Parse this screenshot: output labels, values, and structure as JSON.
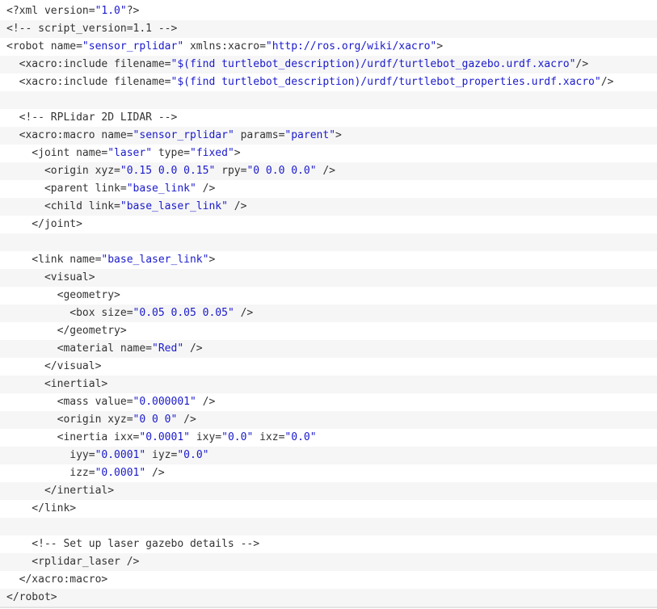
{
  "lines": [
    [
      [
        "<?xml version=",
        "t"
      ],
      [
        "\"1.0\"",
        "s"
      ],
      [
        "?>",
        "t"
      ]
    ],
    [
      [
        "<!-- script_version=1.1 -->",
        "t"
      ]
    ],
    [
      [
        "<robot name=",
        "t"
      ],
      [
        "\"sensor_rplidar\"",
        "s"
      ],
      [
        " xmlns:xacro=",
        "t"
      ],
      [
        "\"http://ros.org/wiki/xacro\"",
        "s"
      ],
      [
        ">",
        "t"
      ]
    ],
    [
      [
        "  <xacro:include filename=",
        "t"
      ],
      [
        "\"$(find turtlebot_description)/urdf/turtlebot_gazebo.urdf.xacro\"",
        "s"
      ],
      [
        "/>",
        "t"
      ]
    ],
    [
      [
        "  <xacro:include filename=",
        "t"
      ],
      [
        "\"$(find turtlebot_description)/urdf/turtlebot_properties.urdf.xacro\"",
        "s"
      ],
      [
        "/>",
        "t"
      ]
    ],
    [],
    [
      [
        "  <!-- RPLidar 2D LIDAR -->",
        "t"
      ]
    ],
    [
      [
        "  <xacro:macro name=",
        "t"
      ],
      [
        "\"sensor_rplidar\"",
        "s"
      ],
      [
        " params=",
        "t"
      ],
      [
        "\"parent\"",
        "s"
      ],
      [
        ">",
        "t"
      ]
    ],
    [
      [
        "    <joint name=",
        "t"
      ],
      [
        "\"laser\"",
        "s"
      ],
      [
        " type=",
        "t"
      ],
      [
        "\"fixed\"",
        "s"
      ],
      [
        ">",
        "t"
      ]
    ],
    [
      [
        "      <origin xyz=",
        "t"
      ],
      [
        "\"0.15 0.0 0.15\"",
        "s"
      ],
      [
        " rpy=",
        "t"
      ],
      [
        "\"0 0.0 0.0\"",
        "s"
      ],
      [
        " />",
        "t"
      ]
    ],
    [
      [
        "      <parent link=",
        "t"
      ],
      [
        "\"base_link\"",
        "s"
      ],
      [
        " />",
        "t"
      ]
    ],
    [
      [
        "      <child link=",
        "t"
      ],
      [
        "\"base_laser_link\"",
        "s"
      ],
      [
        " />",
        "t"
      ]
    ],
    [
      [
        "    </joint>",
        "t"
      ]
    ],
    [],
    [
      [
        "    <link name=",
        "t"
      ],
      [
        "\"base_laser_link\"",
        "s"
      ],
      [
        ">",
        "t"
      ]
    ],
    [
      [
        "      <visual>",
        "t"
      ]
    ],
    [
      [
        "        <geometry>",
        "t"
      ]
    ],
    [
      [
        "          <box size=",
        "t"
      ],
      [
        "\"0.05 0.05 0.05\"",
        "s"
      ],
      [
        " />",
        "t"
      ]
    ],
    [
      [
        "        </geometry>",
        "t"
      ]
    ],
    [
      [
        "        <material name=",
        "t"
      ],
      [
        "\"Red\"",
        "s"
      ],
      [
        " />",
        "t"
      ]
    ],
    [
      [
        "      </visual>",
        "t"
      ]
    ],
    [
      [
        "      <inertial>",
        "t"
      ]
    ],
    [
      [
        "        <mass value=",
        "t"
      ],
      [
        "\"0.000001\"",
        "s"
      ],
      [
        " />",
        "t"
      ]
    ],
    [
      [
        "        <origin xyz=",
        "t"
      ],
      [
        "\"0 0 0\"",
        "s"
      ],
      [
        " />",
        "t"
      ]
    ],
    [
      [
        "        <inertia ixx=",
        "t"
      ],
      [
        "\"0.0001\"",
        "s"
      ],
      [
        " ixy=",
        "t"
      ],
      [
        "\"0.0\"",
        "s"
      ],
      [
        " ixz=",
        "t"
      ],
      [
        "\"0.0\"",
        "s"
      ]
    ],
    [
      [
        "          iyy=",
        "t"
      ],
      [
        "\"0.0001\"",
        "s"
      ],
      [
        " iyz=",
        "t"
      ],
      [
        "\"0.0\"",
        "s"
      ]
    ],
    [
      [
        "          izz=",
        "t"
      ],
      [
        "\"0.0001\"",
        "s"
      ],
      [
        " />",
        "t"
      ]
    ],
    [
      [
        "      </inertial>",
        "t"
      ]
    ],
    [
      [
        "    </link>",
        "t"
      ]
    ],
    [],
    [
      [
        "    <!-- Set up laser gazebo details -->",
        "t"
      ]
    ],
    [
      [
        "    <rplidar_laser />",
        "t"
      ]
    ],
    [
      [
        "  </xacro:macro>",
        "t"
      ]
    ],
    [
      [
        "</robot>",
        "t"
      ]
    ]
  ]
}
